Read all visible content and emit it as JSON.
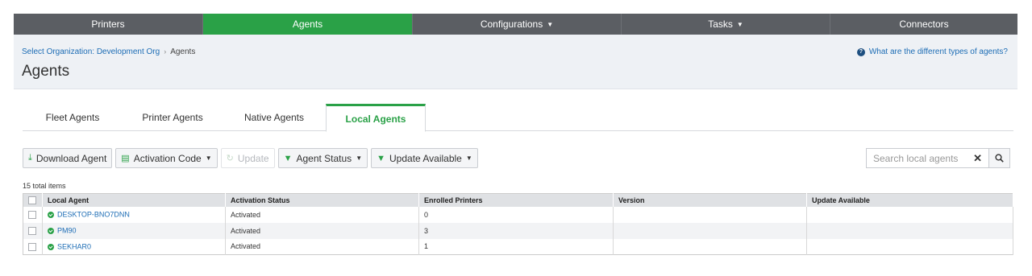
{
  "nav": {
    "items": [
      {
        "label": "Printers",
        "caret": false,
        "active": false
      },
      {
        "label": "Agents",
        "caret": false,
        "active": true
      },
      {
        "label": "Configurations",
        "caret": true,
        "active": false
      },
      {
        "label": "Tasks",
        "caret": true,
        "active": false
      },
      {
        "label": "Connectors",
        "caret": false,
        "active": false
      }
    ]
  },
  "header": {
    "breadcrumb_link": "Select Organization: Development Org",
    "breadcrumb_current": "Agents",
    "title": "Agents",
    "help_link": "What are the different types of agents?"
  },
  "tabs": [
    {
      "label": "Fleet Agents",
      "active": false
    },
    {
      "label": "Printer Agents",
      "active": false
    },
    {
      "label": "Native Agents",
      "active": false
    },
    {
      "label": "Local Agents",
      "active": true
    }
  ],
  "toolbar": {
    "download": "Download Agent",
    "activation_code": "Activation Code",
    "update": "Update",
    "agent_status": "Agent Status",
    "update_available": "Update Available"
  },
  "search": {
    "placeholder": "Search local agents"
  },
  "table": {
    "total": "15 total items",
    "columns": [
      "Local Agent",
      "Activation Status",
      "Enrolled Printers",
      "Version",
      "Update Available"
    ],
    "rows": [
      {
        "agent": "DESKTOP-BNO7DNN",
        "activation": "Activated",
        "enrolled": "0",
        "version": "",
        "update": ""
      },
      {
        "agent": "PM90",
        "activation": "Activated",
        "enrolled": "3",
        "version": "",
        "update": ""
      },
      {
        "agent": "SEKHAR0",
        "activation": "Activated",
        "enrolled": "1",
        "version": "",
        "update": ""
      }
    ]
  },
  "colors": {
    "accent": "#2aa147",
    "nav_bg": "#5b5e63",
    "link": "#1d6db5"
  }
}
